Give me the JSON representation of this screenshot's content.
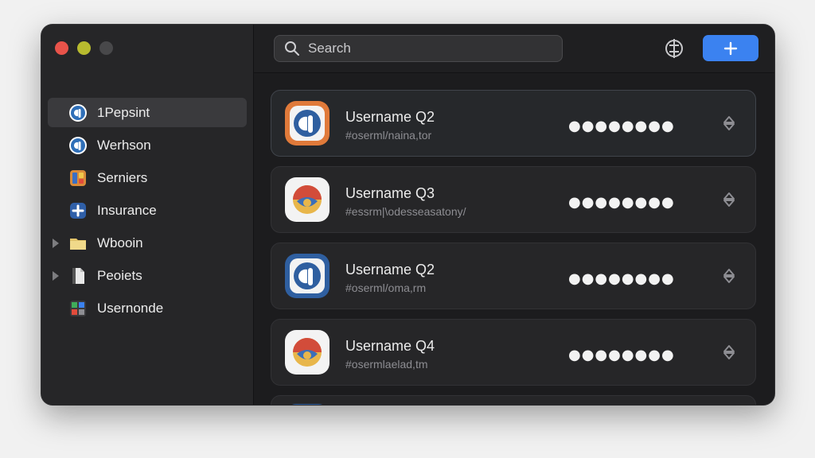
{
  "window": {
    "traffic_lights": [
      "close",
      "minimize",
      "zoom"
    ]
  },
  "sidebar": {
    "items": [
      {
        "label": "1Pepsint",
        "icon": "1password-icon",
        "selected": true,
        "expandable": false
      },
      {
        "label": "Werhson",
        "icon": "1password-icon",
        "selected": false,
        "expandable": false
      },
      {
        "label": "Serniers",
        "icon": "servers-icon",
        "selected": false,
        "expandable": false
      },
      {
        "label": "Insurance",
        "icon": "insurance-icon",
        "selected": false,
        "expandable": false
      },
      {
        "label": "Wbooin",
        "icon": "folder-icon",
        "selected": false,
        "expandable": true
      },
      {
        "label": "Peoiets",
        "icon": "document-icon",
        "selected": false,
        "expandable": true
      },
      {
        "label": "Usernonde",
        "icon": "grid-icon",
        "selected": false,
        "expandable": false
      }
    ]
  },
  "toolbar": {
    "search_placeholder": "Search",
    "add_label": "+"
  },
  "items": [
    {
      "title": "Username Q2",
      "subtitle": "#oserml/naina,tor",
      "password": "●●●●●●●●",
      "icon": "1password-icon",
      "selected": true
    },
    {
      "title": "Username Q3",
      "subtitle": "#essrm|\\odesseasatony/",
      "password": "●●●●●●●●",
      "icon": "colorful-app-icon",
      "selected": false
    },
    {
      "title": "Username Q2",
      "subtitle": "#oserml/oma,rm",
      "password": "●●●●●●●●",
      "icon": "1password-icon",
      "selected": false
    },
    {
      "title": "Username Q4",
      "subtitle": "#osermlaelad,tm",
      "password": "●●●●●●●●",
      "icon": "colorful-app-icon",
      "selected": false
    }
  ],
  "colors": {
    "accent": "#3b82f0",
    "close": "#e8534a",
    "minimize": "#b8bb2f",
    "zoom": "#48484a"
  }
}
